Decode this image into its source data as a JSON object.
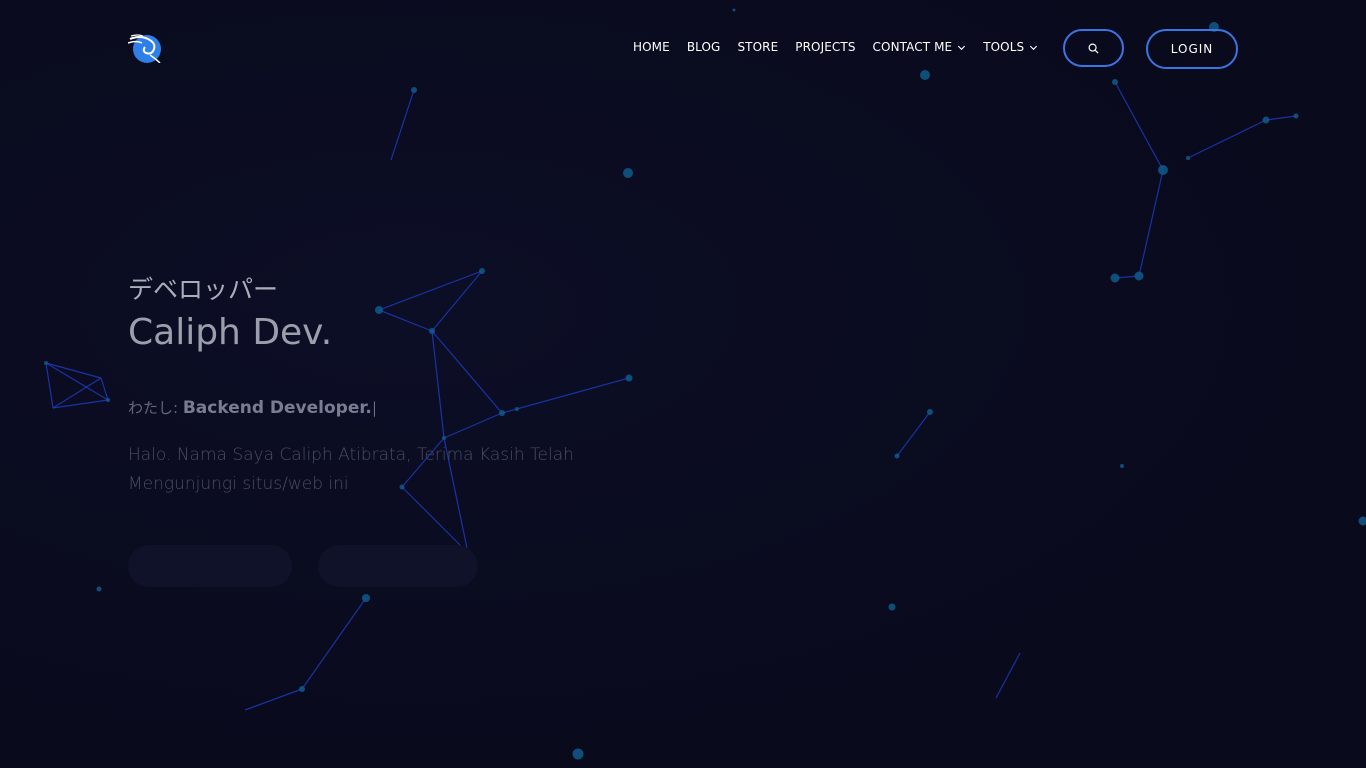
{
  "header": {
    "logo": {
      "icon": "kali-dragon-icon",
      "accent": "#2f7fe8"
    },
    "nav": [
      {
        "label": "HOME",
        "dropdown": false
      },
      {
        "label": "BLOG",
        "dropdown": false
      },
      {
        "label": "STORE",
        "dropdown": false
      },
      {
        "label": "PROJECTS",
        "dropdown": false
      },
      {
        "label": "CONTACT ME",
        "dropdown": true
      },
      {
        "label": "TOOLS",
        "dropdown": true
      }
    ],
    "search_icon": "search-icon",
    "login_label": "LOGIN",
    "button_border_color": "#3b74e3"
  },
  "hero": {
    "subtitle_jp": "デベロッパー",
    "title": "Caliph Dev.",
    "role_prefix": "わたし:",
    "role": "Backend Developer.",
    "cursor": "|",
    "intro": "Halo. Nama Saya Caliph Atibrata, Terima Kasih Telah Mengunjungi situs/web ini",
    "cta_primary": "",
    "cta_secondary": ""
  },
  "colors": {
    "background": "#0a0b1f",
    "network_line": "#1f3fd0",
    "network_node": "#0f5a8a"
  }
}
